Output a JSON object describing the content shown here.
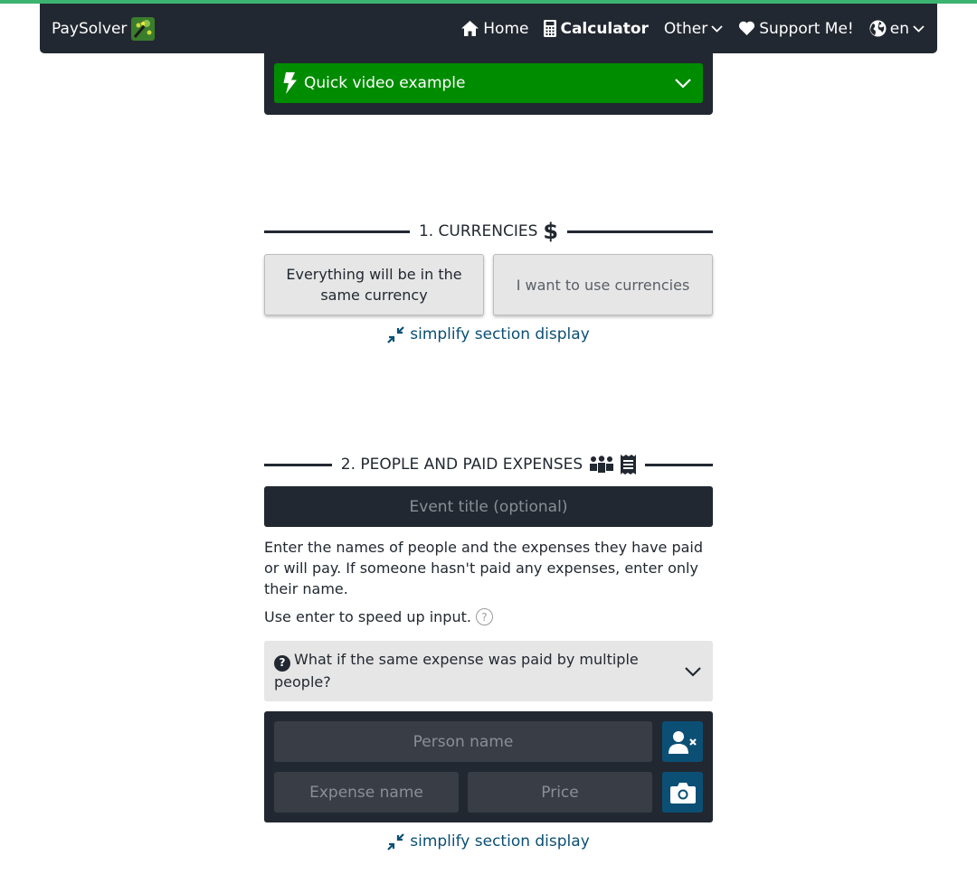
{
  "nav": {
    "brand": "PaySolver",
    "items": [
      {
        "label": "Home",
        "icon": "home-icon"
      },
      {
        "label": "Calculator",
        "icon": "calculator-icon",
        "active": true
      },
      {
        "label": "Other",
        "icon": "chevron-down-icon"
      },
      {
        "label": "Support Me!",
        "icon": "heart-icon"
      },
      {
        "label": "en",
        "icon": "globe-icon"
      }
    ]
  },
  "video": {
    "label": "Quick video example"
  },
  "currencies": {
    "title": "1. CURRENCIES",
    "option_same": "Everything will be in the same currency",
    "option_multi": "I want to use currencies",
    "simplify": "simplify section display"
  },
  "people": {
    "title": "2. PEOPLE AND PAID EXPENSES",
    "event_placeholder": "Event title (optional)",
    "instructions": "Enter the names of people and the expenses they have paid or will pay. If someone hasn't paid any expenses, enter only their name.",
    "hint": "Use enter to speed up input.",
    "hint_icon": "?",
    "faq_icon": "?",
    "faq": "What if the same expense was paid by multiple people?",
    "person_placeholder": "Person name",
    "expense_placeholder": "Expense name",
    "price_placeholder": "Price",
    "simplify": "simplify section display"
  },
  "colors": {
    "navbar": "#222831",
    "accent_green": "#008c00",
    "link_blue": "#0b4f75",
    "top_line": "#3cb371"
  }
}
